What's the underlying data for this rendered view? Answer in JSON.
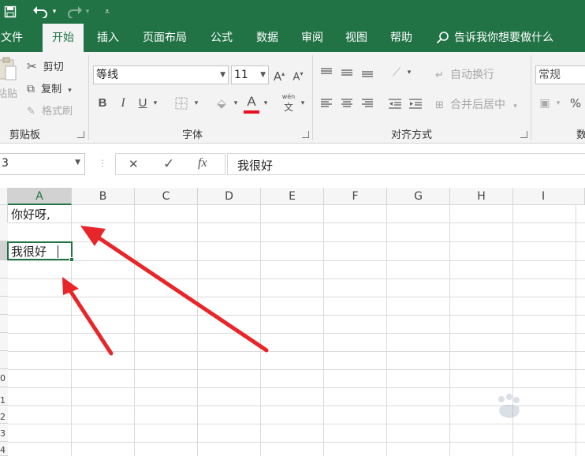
{
  "qat": {
    "save_icon": "save-icon",
    "undo_icon": "undo-icon",
    "redo_icon": "redo-icon",
    "customize_icon": "customize-qat-icon"
  },
  "tabs": [
    {
      "label": "文件"
    },
    {
      "label": "开始"
    },
    {
      "label": "插入"
    },
    {
      "label": "页面布局"
    },
    {
      "label": "公式"
    },
    {
      "label": "数据"
    },
    {
      "label": "审阅"
    },
    {
      "label": "视图"
    },
    {
      "label": "帮助"
    }
  ],
  "active_tab": "开始",
  "tell_me": "告诉我你想要做什么",
  "clipboard": {
    "cut": "剪切",
    "copy": "复制",
    "format_painter": "格式刷",
    "paste": "粘贴",
    "group": "剪贴板"
  },
  "font": {
    "name": "等线",
    "size": "11",
    "bold": "B",
    "italic": "I",
    "underline": "U",
    "font_color": "A",
    "pinyin": "wén",
    "pinyin_char": "文",
    "grow": "A",
    "shrink": "A",
    "group": "字体",
    "color_accent": "#e81123"
  },
  "alignment": {
    "wrap_text": "自动换行",
    "merge_center": "合并后居中",
    "group": "对齐方式"
  },
  "number": {
    "format": "常规",
    "percent": "%",
    "group_partial": "数"
  },
  "formula_bar": {
    "name_box": "3",
    "cancel": "✕",
    "enter": "✓",
    "fx": "fx",
    "content": "我很好"
  },
  "columns": [
    "A",
    "B",
    "C",
    "D",
    "E",
    "F",
    "G",
    "H",
    "I"
  ],
  "row_fragments": [
    "0",
    "1",
    "2",
    "3",
    "4"
  ],
  "cells": {
    "A1": "你好呀,",
    "A3": "我很好"
  },
  "theme": {
    "green": "#217346",
    "arrow": "#e8262a"
  }
}
